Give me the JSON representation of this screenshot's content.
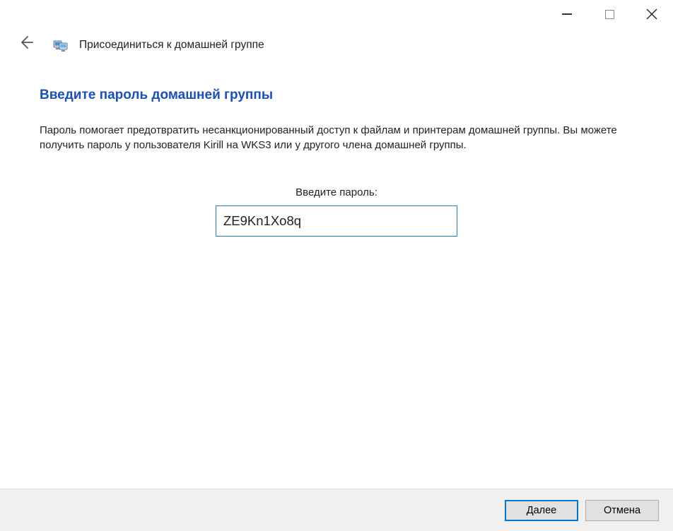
{
  "titlebar": {
    "minimize": "–",
    "maximize": "□",
    "close": "✕"
  },
  "header": {
    "title": "Присоединиться к домашней группе"
  },
  "content": {
    "heading": "Введите пароль домашней группы",
    "description": "Пароль помогает предотвратить несанкционированный доступ к файлам и принтерам домашней группы. Вы можете получить пароль у пользователя Kirill на WKS3 или у другого члена домашней группы.",
    "password_label": "Введите пароль:",
    "password_value": "ZE9Kn1Xo8q"
  },
  "footer": {
    "next_label": "Далее",
    "cancel_label": "Отмена"
  }
}
